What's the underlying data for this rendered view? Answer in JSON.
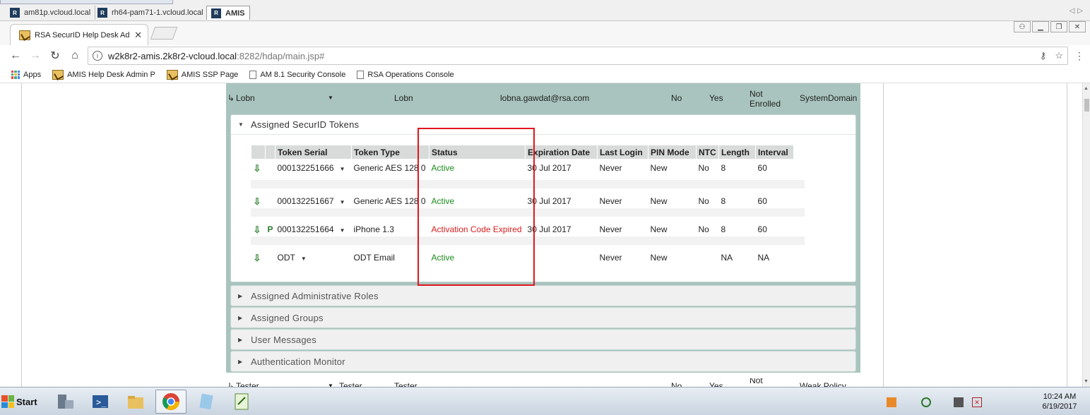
{
  "rdp_tabs": [
    {
      "label": "am81p.vcloud.local"
    },
    {
      "label": "rh64-pam71-1.vcloud.local"
    },
    {
      "label": "AMIS"
    }
  ],
  "rdp_icon_text": "R",
  "browser": {
    "tab_title": "RSA SecurID Help Desk Adm",
    "url_host": "w2k8r2-amis.2k8r2-vcloud.local",
    "url_rest": ":8282/hdap/main.jsp#"
  },
  "bookmarks": [
    {
      "label": "Apps",
      "icon": "apps-grid-icon"
    },
    {
      "label": "AMIS Help Desk Admin P",
      "icon": "rsa-favicon"
    },
    {
      "label": "AMIS SSP Page",
      "icon": "rsa-favicon"
    },
    {
      "label": "AM 8.1 Security Console",
      "icon": "page-icon"
    },
    {
      "label": "RSA Operations Console",
      "icon": "page-icon"
    }
  ],
  "user": {
    "name": "Lobn",
    "first_name": "Lobn",
    "email": "lobna.gawdat@rsa.com",
    "col_a": "No",
    "col_b": "Yes",
    "enrolled_1": "Not",
    "enrolled_2": "Enrolled",
    "domain": "SystemDomain"
  },
  "tokens_section": {
    "title": "Assigned SecurID Tokens",
    "headers": [
      "Token Serial",
      "Token Type",
      "Status",
      "Expiration Date",
      "Last Login",
      "PIN Mode",
      "NTC",
      "Length",
      "Interval"
    ],
    "rows": [
      {
        "p": "",
        "serial": "000132251666",
        "type": "Generic AES 128 0",
        "status": "Active",
        "status_kind": "ok",
        "exp": "30 Jul 2017",
        "last": "Never",
        "pin": "New",
        "ntc": "No",
        "len": "8",
        "interval": "60"
      },
      {
        "p": "",
        "serial": "000132251667",
        "type": "Generic AES 128 0",
        "status": "Active",
        "status_kind": "ok",
        "exp": "30 Jul 2017",
        "last": "Never",
        "pin": "New",
        "ntc": "No",
        "len": "8",
        "interval": "60"
      },
      {
        "p": "P",
        "serial": "000132251664",
        "type": "iPhone 1.3",
        "status": "Activation Code Expired",
        "status_kind": "bad",
        "exp": "30 Jul 2017",
        "last": "Never",
        "pin": "New",
        "ntc": "No",
        "len": "8",
        "interval": "60"
      },
      {
        "p": "",
        "serial": "ODT",
        "type": "ODT Email",
        "status": "Active",
        "status_kind": "ok",
        "exp": "",
        "last": "Never",
        "pin": "New",
        "ntc": "",
        "len": "NA",
        "interval": "NA"
      }
    ]
  },
  "collapsed_sections": [
    "Assigned Administrative Roles",
    "Assigned Groups",
    "User Messages",
    "Authentication Monitor"
  ],
  "next_user": {
    "name": "Tester",
    "first_name": "Tester",
    "last_name": "Tester",
    "col_a": "No",
    "col_b": "Yes",
    "enrolled_1": "Not",
    "policy": "Weak Policy"
  },
  "taskbar": {
    "start_label": "Start",
    "time": "10:24 AM",
    "date": "6/19/2017"
  },
  "colors": {
    "status_ok": "#1a8a1a",
    "status_bad": "#d81e1e",
    "highlight_box": "#e0161e",
    "panel_bg": "#a9c4be"
  }
}
